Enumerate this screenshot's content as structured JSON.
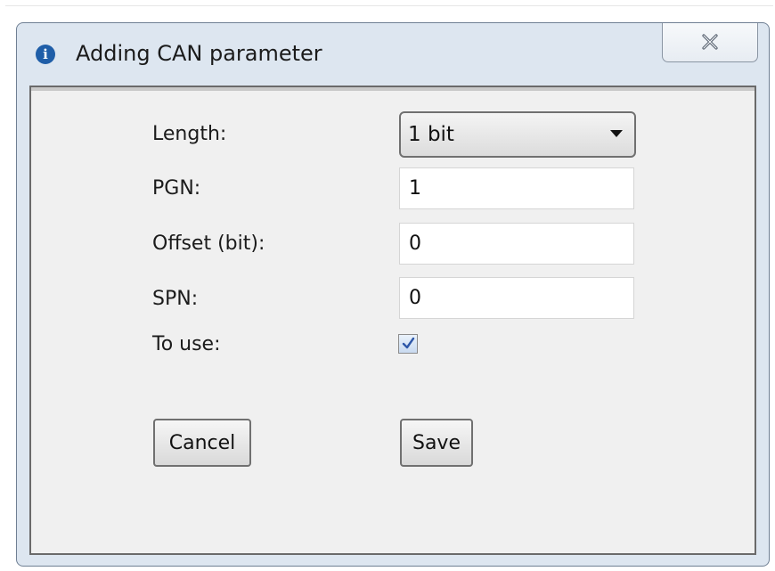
{
  "window": {
    "title": "Adding CAN parameter",
    "title_icon": "info-icon",
    "close_icon": "close-icon"
  },
  "form": {
    "length": {
      "label": "Length:",
      "value": "1 bit"
    },
    "pgn": {
      "label": "PGN:",
      "value": "1"
    },
    "offset": {
      "label": "Offset (bit):",
      "value": "0"
    },
    "spn": {
      "label": "SPN:",
      "value": "0"
    },
    "to_use": {
      "label": "To use:",
      "checked": true
    }
  },
  "buttons": {
    "cancel_label": "Cancel",
    "save_label": "Save"
  },
  "colors": {
    "accent": "#1f5ea8",
    "window_frame": "#dde6f0",
    "client_background": "#f0f0f0"
  }
}
